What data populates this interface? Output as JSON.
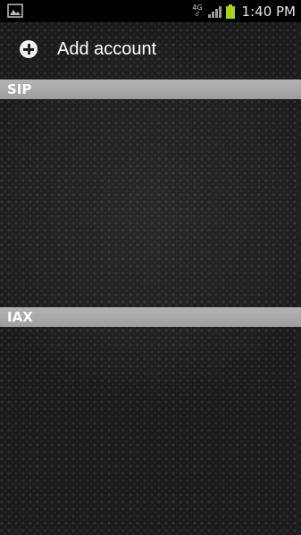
{
  "status_bar": {
    "network": "4G",
    "time": "1:40 PM",
    "icons": [
      "gallery-notification-icon",
      "signal-icon",
      "battery-icon"
    ],
    "battery_color": "#a6d31c"
  },
  "header": {
    "add_account_label": "Add account"
  },
  "sections": [
    {
      "label": "SIP"
    },
    {
      "label": "IAX"
    }
  ],
  "colors": {
    "section_header_bg": "#a8a8a8",
    "background": "#1b1b1b"
  }
}
